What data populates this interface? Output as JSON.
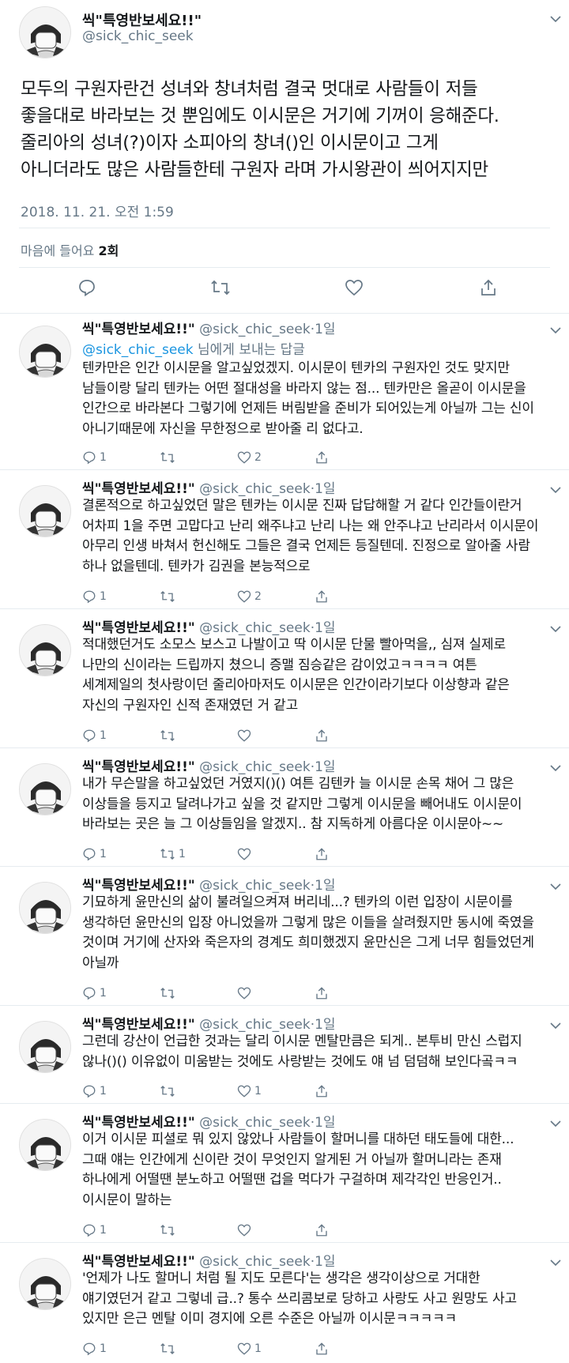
{
  "main_tweet": {
    "author_name": "씩\"특영반보세요!!\"",
    "author_handle": "@sick_chic_seek",
    "text": "모두의 구원자란건 성녀와 창녀처럼 결국 멋대로 사람들이 저들\n좋을대로 바라보는 것 뿐임에도 이시문은 거기에 기꺼이 응해준다.\n줄리아의 성녀(?)이자 소피아의 창녀()인 이시문이고 그게\n아니더라도 많은 사람들한테 구원자 라며 가시왕관이 씌어지지만",
    "timestamp": "2018. 11. 21. 오전 1:59",
    "likes_label": "마음에 들어요",
    "likes_count": "2회",
    "actions": [
      "reply-icon",
      "retweet-icon",
      "like-icon",
      "share-icon"
    ]
  },
  "replies": [
    {
      "author_name": "씩\"특영반보세요!!\"",
      "author_handle": "@sick_chic_seek",
      "dot": "·",
      "time": "1일",
      "reply_to_mention": "@sick_chic_seek",
      "reply_to_suffix": " 님에게 보내는 답글",
      "text": "텐카만은 인간 이시문을 알고싶었겠지. 이시문이 텐카의 구원자인 것도 맞지만\n남들이랑 달리 텐카는 어떤 절대성을 바라지 않는 점... 텐카만은 올곧이 이시문을\n인간으로 바라본다 그렇기에 언제든 버림받을 준비가 되어있는게 아닐까 그는 신이\n아니기때문에 자신을 무한정으로 받아줄 리 없다고.",
      "reply_count": "1",
      "retweet_count": "",
      "like_count": "2"
    },
    {
      "author_name": "씩\"특영반보세요!!\"",
      "author_handle": "@sick_chic_seek",
      "dot": "·",
      "time": "1일",
      "text": "결론적으로 하고싶었던 말은 텐카는 이시문 진짜 답답해할 거 같다 인간들이란거\n어차피 1을 주면 고맙다고 난리 왜주냐고 난리 나는 왜 안주냐고 난리라서 이시문이\n아무리 인생 바쳐서 헌신해도 그들은 결국 언제든 등질텐데. 진정으로 알아줄 사람\n하나 없을텐데. 텐카가 김권을 본능적으로",
      "reply_count": "1",
      "retweet_count": "",
      "like_count": "2"
    },
    {
      "author_name": "씩\"특영반보세요!!\"",
      "author_handle": "@sick_chic_seek",
      "dot": "·",
      "time": "1일",
      "text": "적대했던거도 소모스 보스고 나발이고 딱 이시문 단물 빨아먹을,, 심져 실제로\n나만의 신이라는 드립까지 쳤으니 증맬 짐승같은 감이었고ㅋㅋㅋㅋ 여튼\n세계제일의 첫사랑이던 줄리아마저도 이시문은 인간이라기보다 이상향과 같은\n자신의 구원자인 신적 존재였던 거 같고",
      "reply_count": "1",
      "retweet_count": "",
      "like_count": ""
    },
    {
      "author_name": "씩\"특영반보세요!!\"",
      "author_handle": "@sick_chic_seek",
      "dot": "·",
      "time": "1일",
      "text": "내가 무슨말을 하고싶었던 거였지()() 여튼 김텐카 늘 이시문 손목 채어 그 많은\n이상들을 등지고 달려나가고 싶을 것 같지만 그렇게 이시문을 빼어내도 이시문이\n바라보는 곳은 늘 그 이상들임을 알겠지.. 참 지독하게 아름다운 이시문아~~",
      "reply_count": "1",
      "retweet_count": "1",
      "like_count": ""
    },
    {
      "author_name": "씩\"특영반보세요!!\"",
      "author_handle": "@sick_chic_seek",
      "dot": "·",
      "time": "1일",
      "text": "기묘하게 윤만신의 삶이 불려일으켜져 버리네...? 텐카의 이런 입장이 시문이를\n생각하던 윤만신의 입장 아니었을까 그렇게 많은 이들을 살려줬지만 동시에 죽였을\n것이며 거기에 산자와 죽은자의 경계도 희미했겠지 윤만신은 그게 너무 힘들었던게\n아닐까",
      "reply_count": "1",
      "retweet_count": "",
      "like_count": ""
    },
    {
      "author_name": "씩\"특영반보세요!!\"",
      "author_handle": "@sick_chic_seek",
      "dot": "·",
      "time": "1일",
      "text": "그런데 강산이 언급한 것과는 달리 이시문 멘탈만큼은 되게.. 본투비 만신 스럽지\n않나()() 이유없이 미움받는 것에도 사랑받는 것에도 얘 넘 덤덤해 보인다곸ㅋㅋ",
      "reply_count": "1",
      "retweet_count": "",
      "like_count": "1"
    },
    {
      "author_name": "씩\"특영반보세요!!\"",
      "author_handle": "@sick_chic_seek",
      "dot": "·",
      "time": "1일",
      "text": "이거 이시문 피셜로 뭐 있지 않았나 사람들이 할머니를 대하던 태도들에 대한...\n그때 얘는 인간에게 신이란 것이 무엇인지 알게된 거 아닐까 할머니라는 존재\n하나에게 어떨땐 분노하고 어떨땐 겁을 먹다가 구걸하며 제각각인 반응인거..\n이시문이 말하는",
      "reply_count": "1",
      "retweet_count": "",
      "like_count": ""
    },
    {
      "author_name": "씩\"특영반보세요!!\"",
      "author_handle": "@sick_chic_seek",
      "dot": "·",
      "time": "1일",
      "text": "'언제가 나도 할머니 처럼 될 지도 모른다'는 생각은 생각이상으로 거대한\n얘기였던거 같고 그렇네 급..? 통수 쓰리콤보로 당하고 사랑도 사고 원망도 사고\n있지만 은근 멘탈 이미 경지에 오른 수준은 아닐까 이시문ㅋㅋㅋㅋㅋ",
      "reply_count": "1",
      "retweet_count": "",
      "like_count": "1"
    }
  ],
  "colors": {
    "text_primary": "#14171a",
    "text_secondary": "#657786",
    "link": "#1b95e0",
    "divider": "#e6ecf0"
  }
}
